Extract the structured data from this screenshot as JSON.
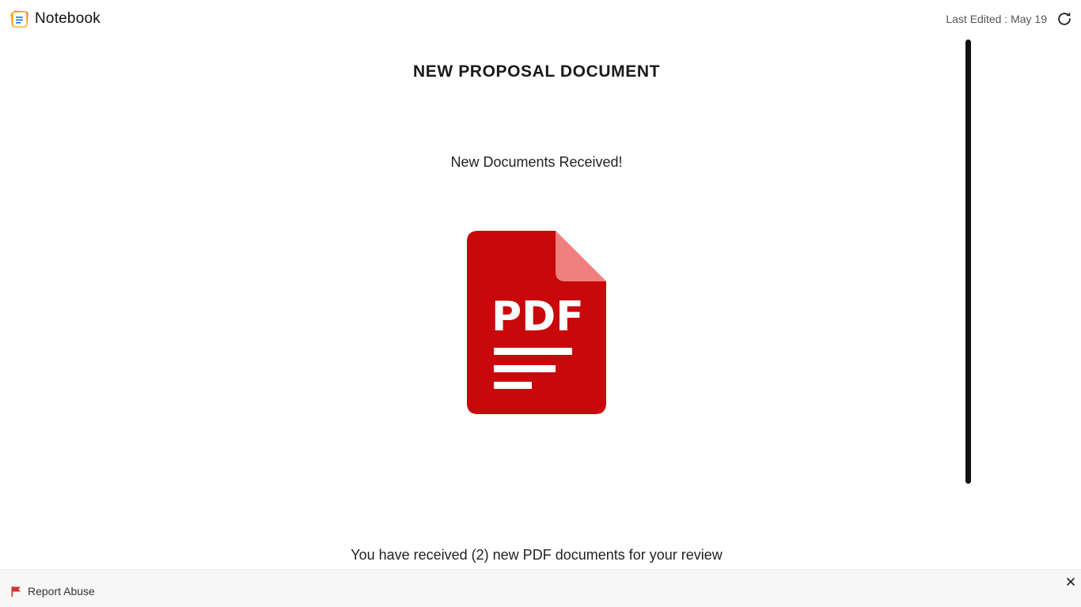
{
  "header": {
    "app_name": "Notebook",
    "last_edited": "Last Edited : May 19"
  },
  "document": {
    "title": "NEW PROPOSAL DOCUMENT",
    "subtitle": "New Documents Received!",
    "file_icon_label": "PDF",
    "message": "You have received (2) new PDF documents for your review"
  },
  "footer": {
    "report_label": "Report Abuse"
  },
  "icons": {
    "brand": "notebook-icon",
    "refresh": "refresh-icon",
    "file": "pdf-file-icon",
    "report": "flag-icon",
    "close": "close-icon"
  },
  "colors": {
    "pdf_red": "#c8080a",
    "pdf_fold": "#f08080",
    "flag_red": "#d32f2f",
    "scrollbar": "#111111"
  }
}
